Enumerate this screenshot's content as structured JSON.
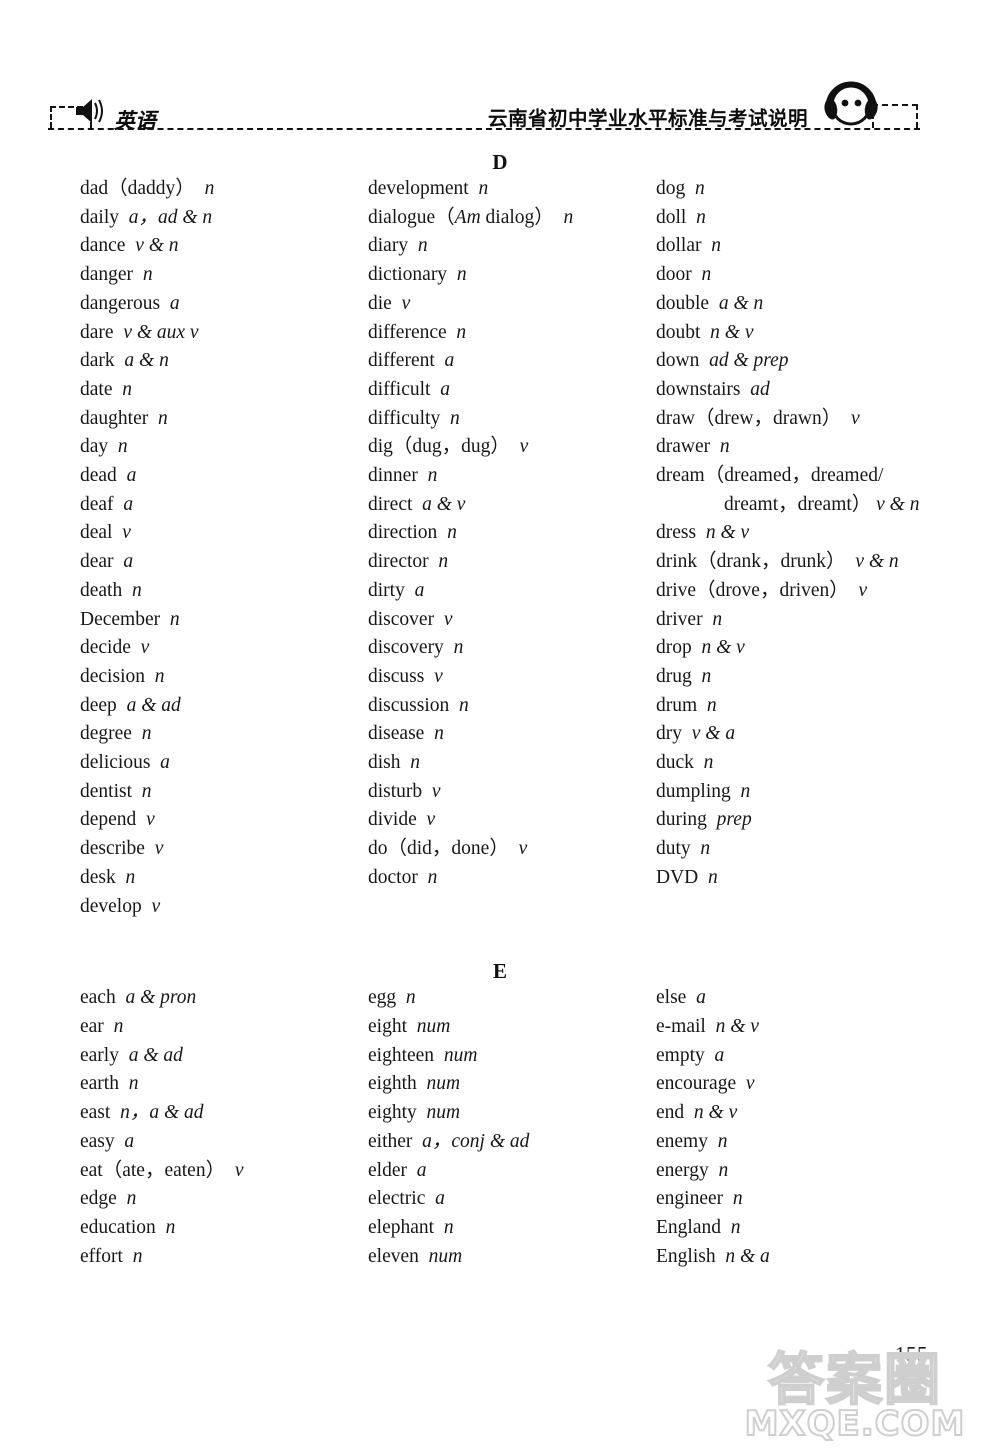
{
  "header": {
    "subject": "英语",
    "title": "云南省初中学业水平标准与考试说明",
    "speaker_icon": "speaker-icon",
    "headphone_icon": "headphone-icon"
  },
  "footer": {
    "page_number": "155",
    "watermark_cn": "答案圈",
    "watermark_url": "MXQE.COM"
  },
  "sections": [
    {
      "letter": "D",
      "columns": [
        [
          {
            "word": "dad（daddy）",
            "pos": "n"
          },
          {
            "word": "daily",
            "pos": "a，ad & n"
          },
          {
            "word": "dance",
            "pos": "v & n"
          },
          {
            "word": "danger",
            "pos": "n"
          },
          {
            "word": "dangerous",
            "pos": "a"
          },
          {
            "word": "dare",
            "pos": "v & aux v"
          },
          {
            "word": "dark",
            "pos": "a & n"
          },
          {
            "word": "date",
            "pos": "n"
          },
          {
            "word": "daughter",
            "pos": "n"
          },
          {
            "word": "day",
            "pos": "n"
          },
          {
            "word": "dead",
            "pos": "a"
          },
          {
            "word": "deaf",
            "pos": "a"
          },
          {
            "word": "deal",
            "pos": "v"
          },
          {
            "word": "dear",
            "pos": "a"
          },
          {
            "word": "death",
            "pos": "n"
          },
          {
            "word": "December",
            "pos": "n"
          },
          {
            "word": "decide",
            "pos": "v"
          },
          {
            "word": "decision",
            "pos": "n"
          },
          {
            "word": "deep",
            "pos": "a & ad"
          },
          {
            "word": "degree",
            "pos": "n"
          },
          {
            "word": "delicious",
            "pos": "a"
          },
          {
            "word": "dentist",
            "pos": "n"
          },
          {
            "word": "depend",
            "pos": "v"
          },
          {
            "word": "describe",
            "pos": "v"
          },
          {
            "word": "desk",
            "pos": "n"
          },
          {
            "word": "develop",
            "pos": "v"
          }
        ],
        [
          {
            "word": "development",
            "pos": "n"
          },
          {
            "word": "dialogue（",
            "italic_inline": "Am",
            "word_tail": " dialog）",
            "pos": "n"
          },
          {
            "word": "diary",
            "pos": "n"
          },
          {
            "word": "dictionary",
            "pos": "n"
          },
          {
            "word": "die",
            "pos": "v"
          },
          {
            "word": "difference",
            "pos": "n"
          },
          {
            "word": "different",
            "pos": "a"
          },
          {
            "word": "difficult",
            "pos": "a"
          },
          {
            "word": "difficulty",
            "pos": "n"
          },
          {
            "word": "dig（dug，dug）",
            "pos": "v"
          },
          {
            "word": "dinner",
            "pos": "n"
          },
          {
            "word": "direct",
            "pos": "a & v"
          },
          {
            "word": "direction",
            "pos": "n"
          },
          {
            "word": "director",
            "pos": "n"
          },
          {
            "word": "dirty",
            "pos": "a"
          },
          {
            "word": "discover",
            "pos": "v"
          },
          {
            "word": "discovery",
            "pos": "n"
          },
          {
            "word": "discuss",
            "pos": "v"
          },
          {
            "word": "discussion",
            "pos": "n"
          },
          {
            "word": "disease",
            "pos": "n"
          },
          {
            "word": "dish",
            "pos": "n"
          },
          {
            "word": "disturb",
            "pos": "v"
          },
          {
            "word": "divide",
            "pos": "v"
          },
          {
            "word": "do（did，done）",
            "pos": "v"
          },
          {
            "word": "doctor",
            "pos": "n"
          }
        ],
        [
          {
            "word": "dog",
            "pos": "n"
          },
          {
            "word": "doll",
            "pos": "n"
          },
          {
            "word": "dollar",
            "pos": "n"
          },
          {
            "word": "door",
            "pos": "n"
          },
          {
            "word": "double",
            "pos": "a & n"
          },
          {
            "word": "doubt",
            "pos": "n & v"
          },
          {
            "word": "down",
            "pos": "ad & prep"
          },
          {
            "word": "downstairs",
            "pos": "ad"
          },
          {
            "word": "draw（drew，drawn）",
            "pos": "v"
          },
          {
            "word": "drawer",
            "pos": "n"
          },
          {
            "word": "dream（dreamed，dreamed/",
            "continuation": "dreamt，dreamt）",
            "pos": "v & n",
            "pos_tight": true
          },
          {
            "word": "dress",
            "pos": "n & v"
          },
          {
            "word": "drink（drank，drunk）",
            "pos": "v & n"
          },
          {
            "word": "drive（drove，driven）",
            "pos": "v"
          },
          {
            "word": "driver",
            "pos": "n"
          },
          {
            "word": "drop",
            "pos": "n & v"
          },
          {
            "word": "drug",
            "pos": "n"
          },
          {
            "word": "drum",
            "pos": "n"
          },
          {
            "word": "dry",
            "pos": "v & a"
          },
          {
            "word": "duck",
            "pos": "n"
          },
          {
            "word": "dumpling",
            "pos": "n"
          },
          {
            "word": "during",
            "pos": "prep"
          },
          {
            "word": "duty",
            "pos": "n"
          },
          {
            "word": "DVD",
            "pos": "n"
          }
        ]
      ]
    },
    {
      "letter": "E",
      "columns": [
        [
          {
            "word": "each",
            "pos": "a & pron"
          },
          {
            "word": "ear",
            "pos": "n"
          },
          {
            "word": "early",
            "pos": "a & ad"
          },
          {
            "word": "earth",
            "pos": "n"
          },
          {
            "word": "east",
            "pos": "n，a & ad"
          },
          {
            "word": "easy",
            "pos": "a"
          },
          {
            "word": "eat（ate，eaten）",
            "pos": "v"
          },
          {
            "word": "edge",
            "pos": "n"
          },
          {
            "word": "education",
            "pos": "n"
          },
          {
            "word": "effort",
            "pos": "n"
          }
        ],
        [
          {
            "word": "egg",
            "pos": "n"
          },
          {
            "word": "eight",
            "pos": "num"
          },
          {
            "word": "eighteen",
            "pos": "num"
          },
          {
            "word": "eighth",
            "pos": "num"
          },
          {
            "word": "eighty",
            "pos": "num"
          },
          {
            "word": "either",
            "pos": "a，conj & ad"
          },
          {
            "word": "elder",
            "pos": "a"
          },
          {
            "word": "electric",
            "pos": "a"
          },
          {
            "word": "elephant",
            "pos": "n"
          },
          {
            "word": "eleven",
            "pos": "num"
          }
        ],
        [
          {
            "word": "else",
            "pos": "a"
          },
          {
            "word": "e-mail",
            "pos": "n & v"
          },
          {
            "word": "empty",
            "pos": "a"
          },
          {
            "word": "encourage",
            "pos": "v"
          },
          {
            "word": "end",
            "pos": "n & v"
          },
          {
            "word": "enemy",
            "pos": "n"
          },
          {
            "word": "energy",
            "pos": "n"
          },
          {
            "word": "engineer",
            "pos": "n"
          },
          {
            "word": "England",
            "pos": "n"
          },
          {
            "word": "English",
            "pos": "n & a"
          }
        ]
      ]
    }
  ]
}
